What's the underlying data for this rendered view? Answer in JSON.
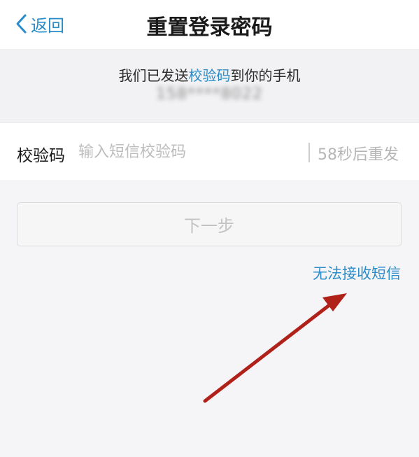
{
  "nav": {
    "back_label": "返回",
    "title": "重置登录密码"
  },
  "info": {
    "sent_prefix": "我们已发送",
    "sent_highlight": "校验码",
    "sent_suffix": "到你的手机",
    "phone_masked": "158****8022"
  },
  "code": {
    "label": "校验码",
    "placeholder": "输入短信校验码",
    "resend": "58秒后重发"
  },
  "next_label": "下一步",
  "no_sms_link": "无法接收短信",
  "colors": {
    "accent": "#2a8cc8",
    "annotation_arrow": "#b0211a"
  },
  "icons": {
    "back": "chevron-left-icon",
    "annotation": "arrow-annotation"
  }
}
